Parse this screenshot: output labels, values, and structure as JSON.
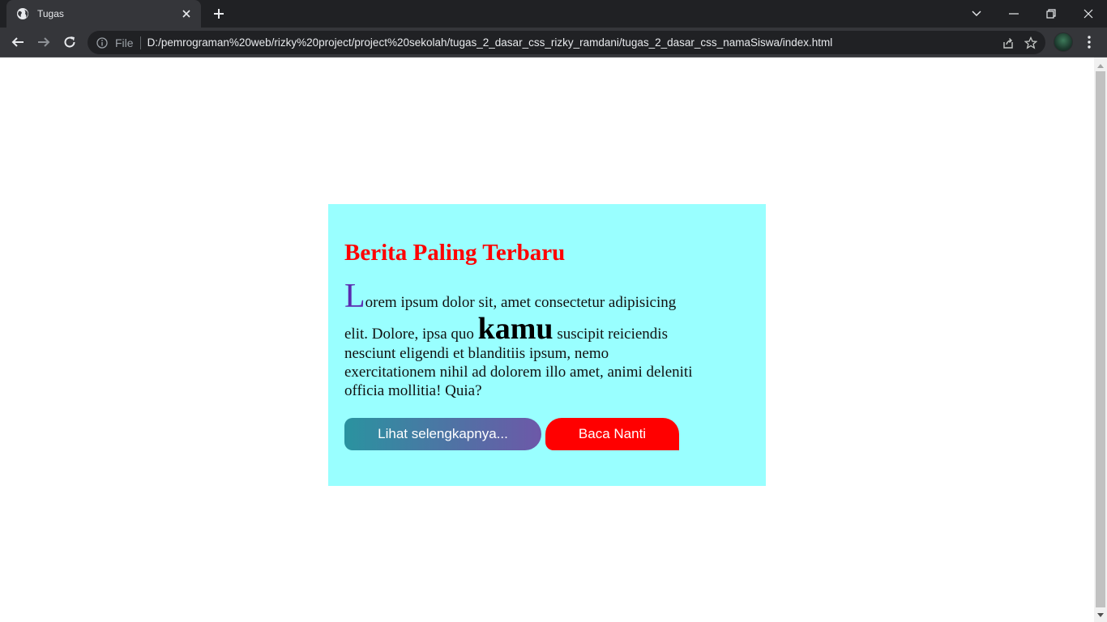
{
  "browser": {
    "tab_title": "Tugas",
    "address": {
      "scheme": "File",
      "url": "D:/pemrograman%20web/rizky%20project/project%20sekolah/tugas_2_dasar_css_rizky_ramdani/tugas_2_dasar_css_namaSiswa/index.html"
    },
    "icons": {
      "favicon": "globe-icon",
      "tab_close": "close-icon",
      "new_tab": "plus-icon",
      "back": "arrow-left-icon",
      "forward": "arrow-right-icon",
      "reload": "reload-icon",
      "site_info": "info-icon",
      "share": "share-icon",
      "bookmark": "star-icon",
      "menu": "more-vertical-icon"
    }
  },
  "page": {
    "heading": "Berita Paling Terbaru",
    "paragraph": {
      "dropcap": "L",
      "part1": "orem ipsum dolor sit, amet consectetur adipisicing elit. Dolore, ipsa quo ",
      "highlight": "kamu",
      "part2": " suscipit reiciendis nesciunt eligendi et blanditiis ipsum, nemo exercitationem nihil ad dolorem illo amet, animi deleniti officia mollitia! Quia?"
    },
    "buttons": {
      "more": "Lihat selengkapnya...",
      "later": "Baca Nanti"
    }
  },
  "colors": {
    "card_background": "#99ffff",
    "heading": "#ff0000",
    "dropcap": "#5b2bb0",
    "button_more_gradient": [
      "#2a93a0",
      "#6d58a8"
    ],
    "button_later": "#ff0000"
  }
}
